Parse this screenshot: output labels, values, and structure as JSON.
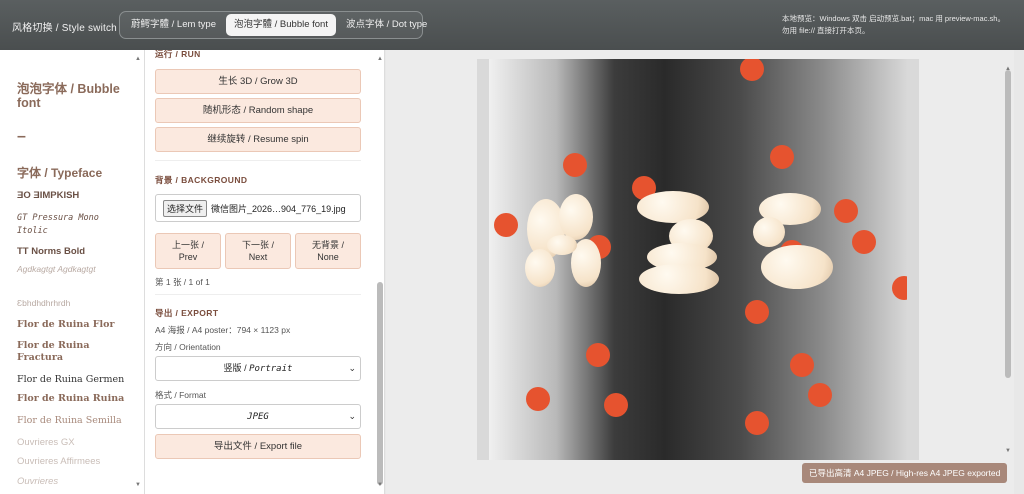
{
  "topbar": {
    "brand": "风格切换 / Style switch",
    "tabs": [
      {
        "label": "蔚鰐字體 / Lem type",
        "active": false
      },
      {
        "label": "泡泡字體 / Bubble font",
        "active": true
      },
      {
        "label": "波点字体 / Dot type",
        "active": false
      }
    ],
    "note": "本地预览：Windows 双击 启动预览.bat；mac 用 preview-mac.sh。勿用 file:// 直接打开本页。"
  },
  "sidebar": {
    "title": "泡泡字体 / Bubble font",
    "dash": "–",
    "section": "字体 / Typeface",
    "fonts": [
      "ƎO ƎIMPKISH",
      "GT Pressura Mono Itolic",
      "TT Norms Bold",
      "Agdkagtgt Agdkagtgt",
      "Ɛbhdhdhrhrdh",
      "Flor de Ruina Flor",
      "Flor de Ruina Fractura",
      "Flor de Ruina Germen",
      "Flor de Ruina Ruina",
      "Flor de Ruina Semilla",
      "Ouvrieres GX",
      "Ouvrieres Affirmees",
      "Ouvrieres"
    ]
  },
  "panel": {
    "run_header": "运行 / RUN",
    "run_buttons": [
      "生长 3D / Grow 3D",
      "随机形态 / Random shape",
      "继续旋转 / Resume spin"
    ],
    "bg_header": "背景 / BACKGROUND",
    "file_button": "选择文件",
    "file_name": "微信图片_2026…904_776_19.jpg",
    "nav_buttons": [
      {
        "cn": "上一张 /",
        "en": "Prev"
      },
      {
        "cn": "下一张 /",
        "en": "Next"
      },
      {
        "cn": "无背景 /",
        "en": "None"
      }
    ],
    "page_count": "第 1 张 / 1 of 1",
    "export_header": "导出 / EXPORT",
    "export_size": "A4 海报 / A4 poster：794 × 1123 px",
    "orientation_label": "方向 / Orientation",
    "orientation_value_cn": "竖版",
    "orientation_value_en": "Portrait",
    "format_label": "格式 / Format",
    "format_value": "JPEG",
    "export_button": "导出文件 / Export file"
  },
  "canvas": {
    "letters": "A3C",
    "accent_color": "#e6532f",
    "toast": "已导出高清 A4 JPEG / High-res A4 JPEG exported"
  }
}
